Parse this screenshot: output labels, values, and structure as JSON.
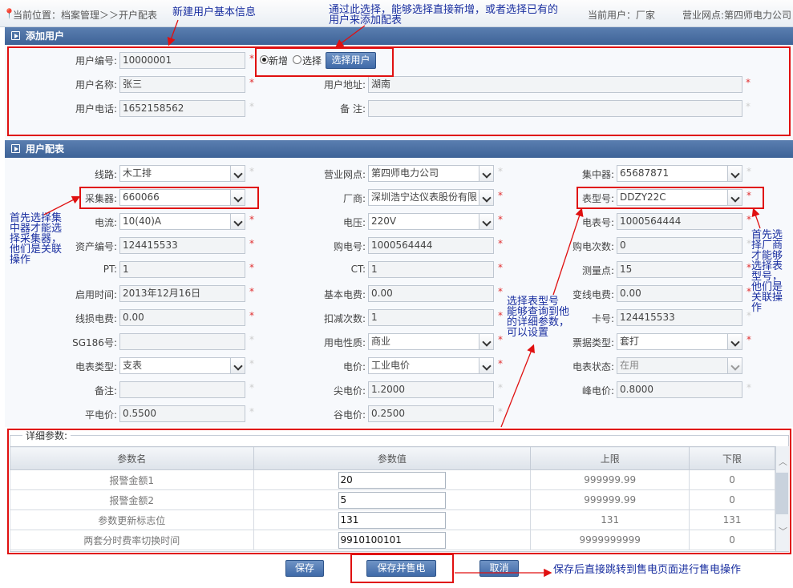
{
  "header": {
    "location": "当前位置：档案管理＞＞开户配表",
    "current_user": "当前用户：厂家",
    "business_point": "营业网点:第四师电力公司"
  },
  "annotations": {
    "new_user": "新建用户基本信息",
    "select_hint_1": "通过此选择，能够选择直接新增，或者选择已有的",
    "select_hint_2": "用户来添加配表",
    "collector_hint": [
      "首先选择集",
      "中器才能选",
      "择采集器，",
      "他们是关联",
      "操作"
    ],
    "meter_hint": [
      "首先选",
      "择厂商",
      "才能够",
      "选择表",
      "型号，",
      "他们是",
      "关联操",
      "作"
    ],
    "param_hint": [
      "选择表型号",
      "能够查询到他",
      "的详细参数，",
      "可以设置"
    ],
    "save_hint": "保存后直接跳转到售电页面进行售电操作"
  },
  "add_user": {
    "title": "添加用户",
    "user_no_label": "用户编号:",
    "user_no": "10000001",
    "radio_new": "新增",
    "radio_select": "选择",
    "select_user_btn": "选择用户",
    "user_name_label": "用户名称:",
    "user_name": "张三",
    "address_label": "用户地址:",
    "address": "湖南",
    "phone_label": "用户电话:",
    "phone": "1652158562",
    "remark_label": "备 注:",
    "remark": ""
  },
  "config": {
    "title": "用户配表",
    "line_label": "线路:",
    "line": "木工排",
    "biz_label": "营业网点:",
    "biz": "第四师电力公司",
    "concentrator_label": "集中器:",
    "concentrator": "65687871",
    "collector_label": "采集器:",
    "collector": "660066",
    "vendor_label": "厂商:",
    "vendor": "深圳浩宁达仪表股份有限",
    "meter_type_label": "表型号:",
    "meter_type": "DDZY22C",
    "current_label": "电流:",
    "current": "10(40)A",
    "voltage_label": "电压:",
    "voltage": "220V",
    "meter_no_label": "电表号:",
    "meter_no": "1000564444",
    "asset_label": "资产编号:",
    "asset": "124415533",
    "buy_no_label": "购电号:",
    "buy_no": "1000564444",
    "buy_count_label": "购电次数:",
    "buy_count": "0",
    "pt_label": "PT:",
    "pt": "1",
    "ct_label": "CT:",
    "ct": "1",
    "point_label": "测量点:",
    "point": "15",
    "start_label": "启用时间:",
    "start": "2013年12月16日",
    "basic_fee_label": "基本电费:",
    "basic_fee": "0.00",
    "trans_fee_label": "变线电费:",
    "trans_fee": "0.00",
    "loss_fee_label": "线损电费:",
    "loss_fee": "0.00",
    "deduct_label": "扣减次数:",
    "deduct": "1",
    "card_label": "卡号:",
    "card": "124415533",
    "sg_label": "SG186号:",
    "sg": "",
    "nature_label": "用电性质:",
    "nature": "商业",
    "ticket_label": "票据类型:",
    "ticket": "套打",
    "mtype_label": "电表类型:",
    "mtype": "支表",
    "price_label": "电价:",
    "price": "工业电价",
    "status_label": "电表状态:",
    "status": "在用",
    "note_label": "备注:",
    "note": "",
    "peak_sharp_label": "尖电价:",
    "peak_sharp": "1.2000",
    "peak_label": "峰电价:",
    "peak": "0.8000",
    "flat_label": "平电价:",
    "flat": "0.5500",
    "valley_label": "谷电价:",
    "valley": "0.2500"
  },
  "params": {
    "legend": "详细参数:",
    "headers": [
      "参数名",
      "参数值",
      "上限",
      "下限"
    ],
    "rows": [
      {
        "name": "报警金额1",
        "value": "20",
        "upper": "999999.99",
        "lower": "0"
      },
      {
        "name": "报警金额2",
        "value": "5",
        "upper": "999999.99",
        "lower": "0"
      },
      {
        "name": "参数更新标志位",
        "value": "131",
        "upper": "131",
        "lower": "131"
      },
      {
        "name": "两套分时费率切换时间",
        "value": "9910100101",
        "upper": "9999999999",
        "lower": "0"
      }
    ]
  },
  "buttons": {
    "save": "保存",
    "save_sell": "保存并售电",
    "cancel": "取消"
  },
  "colors": {
    "accent": "#3e6397",
    "highlight": "#e01010",
    "note": "#1a2fa0"
  }
}
